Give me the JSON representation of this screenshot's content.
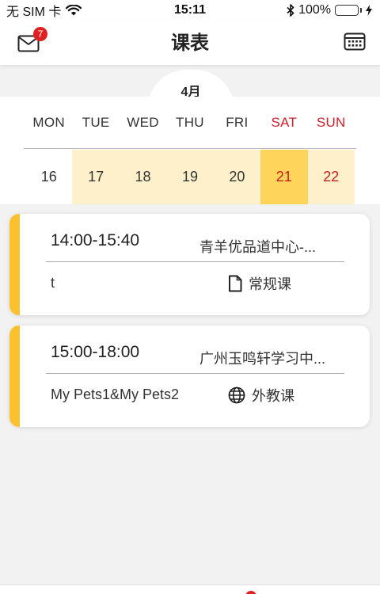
{
  "status_bar": {
    "carrier": "无 SIM 卡",
    "time": "15:11",
    "battery": "100%"
  },
  "header": {
    "title": "课表",
    "mail_badge_count": "7"
  },
  "calendar": {
    "month": "4月",
    "weekdays": [
      "MON",
      "TUE",
      "WED",
      "THU",
      "FRI",
      "SAT",
      "SUN"
    ],
    "dates": [
      "16",
      "17",
      "18",
      "19",
      "20",
      "21",
      "22"
    ],
    "selected_date": "21",
    "colors": {
      "range": "#fff0cc",
      "selected": "#ffd45a",
      "weekend": "#d0202a"
    }
  },
  "lessons": [
    {
      "time": "14:00-15:40",
      "location": "青羊优品道中心-...",
      "description": "t",
      "type": "常规课",
      "type_icon": "document-icon"
    },
    {
      "time": "15:00-18:00",
      "location": "广州玉鸣轩学习中...",
      "description": "My Pets1&My Pets2",
      "type": "外教课",
      "type_icon": "globe-icon"
    }
  ],
  "theme": {
    "accent": "#fbc02d",
    "badge": "#e02020"
  }
}
